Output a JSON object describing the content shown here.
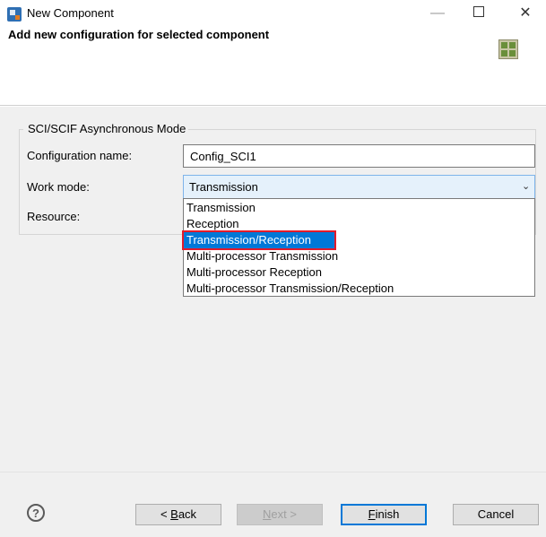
{
  "window": {
    "title": "New Component",
    "minimize_glyph": "—",
    "close_glyph": "✕"
  },
  "header": {
    "title": "Add new configuration for selected component",
    "icon": "component-grid-icon"
  },
  "group": {
    "label": "SCI/SCIF Asynchronous Mode"
  },
  "form": {
    "config_label": "Configuration name:",
    "config_value": "Config_SCI1",
    "work_mode_label": "Work mode:",
    "work_mode_value": "Transmission",
    "resource_label": "Resource:"
  },
  "dropdown": {
    "options": [
      "Transmission",
      "Reception",
      "Transmission/Reception",
      "Multi-processor Transmission",
      "Multi-processor Reception",
      "Multi-processor Transmission/Reception"
    ],
    "highlighted_index": 2,
    "highlight_color": "#0078d7",
    "annotation_color": "#e21b2b"
  },
  "footer": {
    "help_glyph": "?",
    "back_label": "Back",
    "back_prefix": "< ",
    "back_mnemonic": "B",
    "next_label": "Next >",
    "next_mnemonic": "N",
    "finish_label": "Finish",
    "finish_mnemonic": "F",
    "cancel_label": "Cancel"
  }
}
